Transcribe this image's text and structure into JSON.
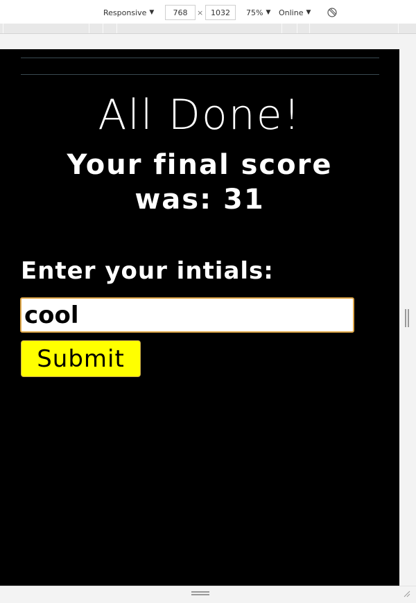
{
  "devtools": {
    "device": "Responsive",
    "width": "768",
    "times": "×",
    "height": "1032",
    "zoom": "75%",
    "network": "Online",
    "rotate_icon": "rotate-icon"
  },
  "page": {
    "title": "All Done!",
    "score_text": "Your final score was: 31",
    "initials_label": "Enter your intials:",
    "initials_value": "cool",
    "submit_label": "Submit"
  },
  "colors": {
    "background": "#000000",
    "input_border": "#e0a84a",
    "submit_bg": "#ffff00"
  }
}
